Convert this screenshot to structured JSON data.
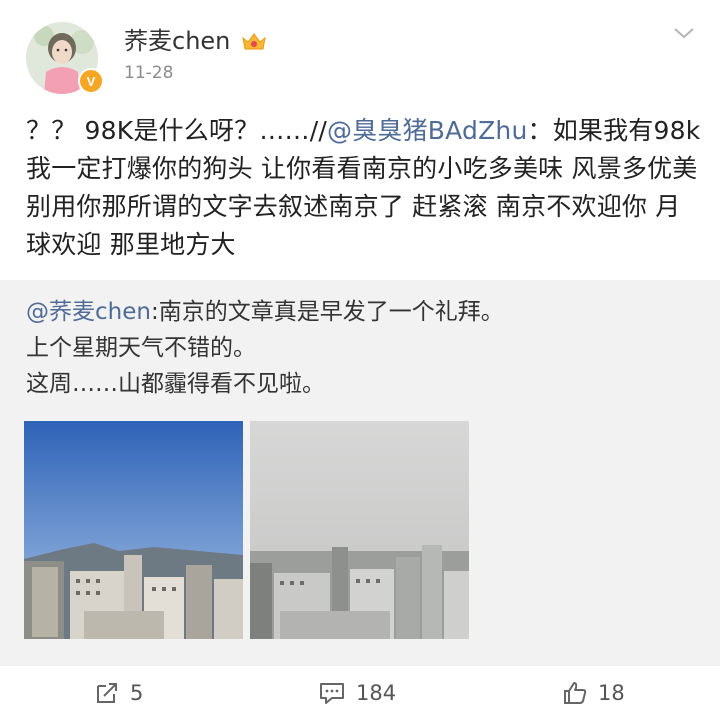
{
  "post": {
    "author": "荞麦chen",
    "time": "11-28",
    "text_prefix": "？？ 98K是什么呀？……//",
    "mention": "@臭臭猪BAdZhu",
    "text_suffix": "：如果我有98k我一定打爆你的狗头 让你看看南京的小吃多美味 风景多优美 别用你那所谓的文字去叙述南京了  赶紧滚 南京不欢迎你  月球欢迎  那里地方大"
  },
  "repost": {
    "mention": "@荞麦chen",
    "line1": ":南京的文章真是早发了一个礼拜。",
    "line2": "上个星期天气不错的。",
    "line3": "这周……山都霾得看不见啦。"
  },
  "actions": {
    "repost_count": "5",
    "comment_count": "184",
    "like_count": "18"
  },
  "icons": {
    "crown": "crown-badge-icon",
    "verified": "verified-v-icon",
    "more": "chevron-down-icon",
    "repost": "share-icon",
    "comment": "comment-icon",
    "like": "thumbs-up-icon"
  },
  "colors": {
    "mention": "#4f6b96",
    "repost_bg": "#f2f2f2",
    "verified": "#f5a623"
  }
}
